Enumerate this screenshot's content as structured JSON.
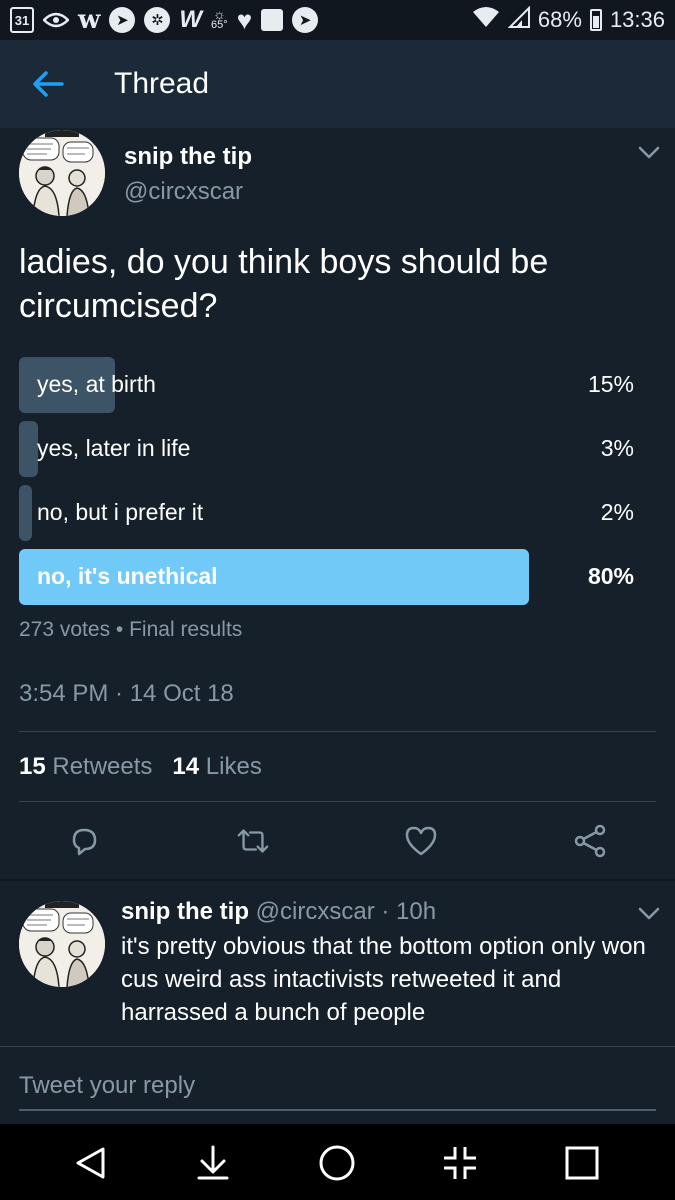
{
  "status_bar": {
    "calendar_day": "31",
    "app_letter_w": "w",
    "app_letter_W": "W",
    "weather_temp": "65°",
    "battery": "68%",
    "time": "13:36",
    "icons": [
      "calendar-icon",
      "eye-icon",
      "w-app-icon",
      "telegram-icon",
      "settings-icon",
      "w-icon",
      "weather-icon",
      "heart-icon",
      "square-icon",
      "telegram-icon",
      "wifi-icon",
      "signal-icon",
      "battery-icon"
    ]
  },
  "header": {
    "title": "Thread"
  },
  "tweet": {
    "name": "snip the tip",
    "handle": "@circxscar",
    "text": "ladies, do you think boys should be circumcised?",
    "poll": {
      "options": [
        {
          "label": "yes, at birth",
          "pct": "15%",
          "value": 15
        },
        {
          "label": "yes, later in life",
          "pct": "3%",
          "value": 3
        },
        {
          "label": "no, but i prefer it",
          "pct": "2%",
          "value": 2
        },
        {
          "label": "no, it's unethical",
          "pct": "80%",
          "value": 80
        }
      ],
      "meta": "273 votes • Final results"
    },
    "timestamp": "3:54 PM · 14 Oct 18",
    "stats": {
      "retweets_count": "15",
      "retweets_label": "Retweets",
      "likes_count": "14",
      "likes_label": "Likes"
    }
  },
  "reply": {
    "name": "snip the tip",
    "meta": "@circxscar · 10h",
    "text": "it's pretty obvious that the bottom option only won cus weird ass intactivists retweeted it and harrassed a bunch of people"
  },
  "compose": {
    "placeholder": "Tweet your reply"
  },
  "colors": {
    "background": "#15202b",
    "header": "#1c2938",
    "accent": "#1da1f2",
    "poll_winner": "#71c9f8",
    "poll_bar": "#3d5466",
    "secondary_text": "#8899a6"
  }
}
